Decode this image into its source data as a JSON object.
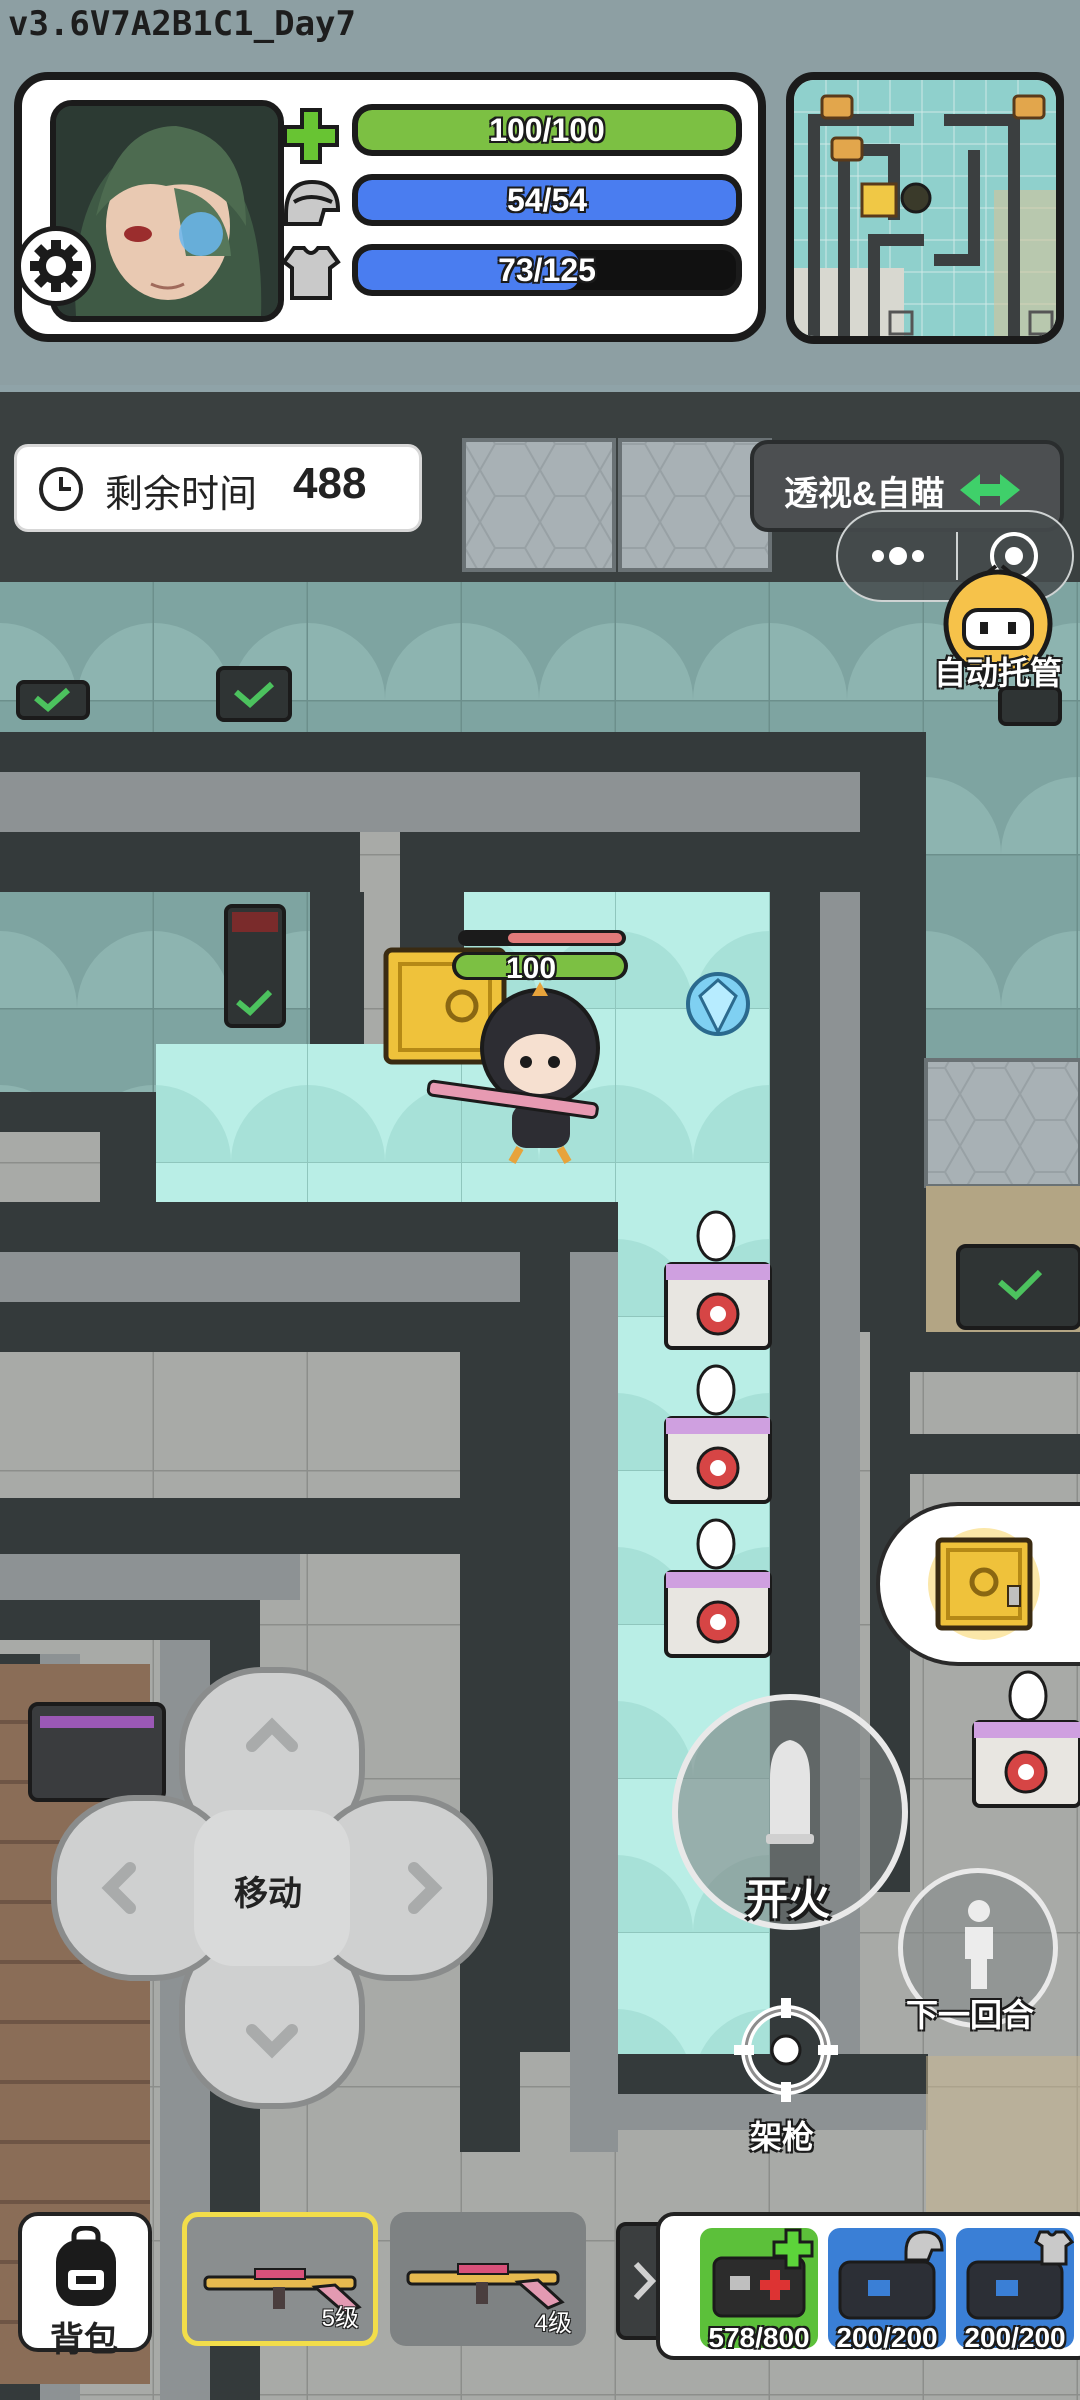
{
  "header": {
    "version": "v3.6V7A2B1C1_Day7",
    "stats": {
      "health": {
        "label": "100/100",
        "current": 100,
        "max": 100,
        "color": "#7cc043"
      },
      "helmet": {
        "label": "54/54",
        "current": 54,
        "max": 54,
        "color": "#4a7df0"
      },
      "armor": {
        "label": "73/125",
        "current": 73,
        "max": 125,
        "color": "#4a7df0"
      }
    },
    "icons": {
      "health": "green-plus-icon",
      "helmet": "helmet-icon",
      "armor": "body-armor-icon",
      "settings": "gear-icon"
    }
  },
  "hud": {
    "timer_label": "剩余时间",
    "timer_value": "488",
    "xray_label": "透视&自瞄",
    "auto_label": "自动托管",
    "move_label": "移动",
    "fire_label": "开火",
    "next_round_label": "下一回合",
    "aim_label": "架枪"
  },
  "player": {
    "hp": "100"
  },
  "bottom": {
    "backpack_label": "背包",
    "weapons": [
      {
        "level": "5级",
        "selected": true
      },
      {
        "level": "4级",
        "selected": false
      }
    ],
    "items": [
      {
        "count": "578/800",
        "icon": "medkit-icon",
        "color": "#6dbb3a"
      },
      {
        "count": "200/200",
        "icon": "helmet-repair-bag-icon",
        "color": "#3a7fd6"
      },
      {
        "count": "200/200",
        "icon": "armor-repair-bag-icon",
        "color": "#3a7fd6"
      }
    ]
  }
}
